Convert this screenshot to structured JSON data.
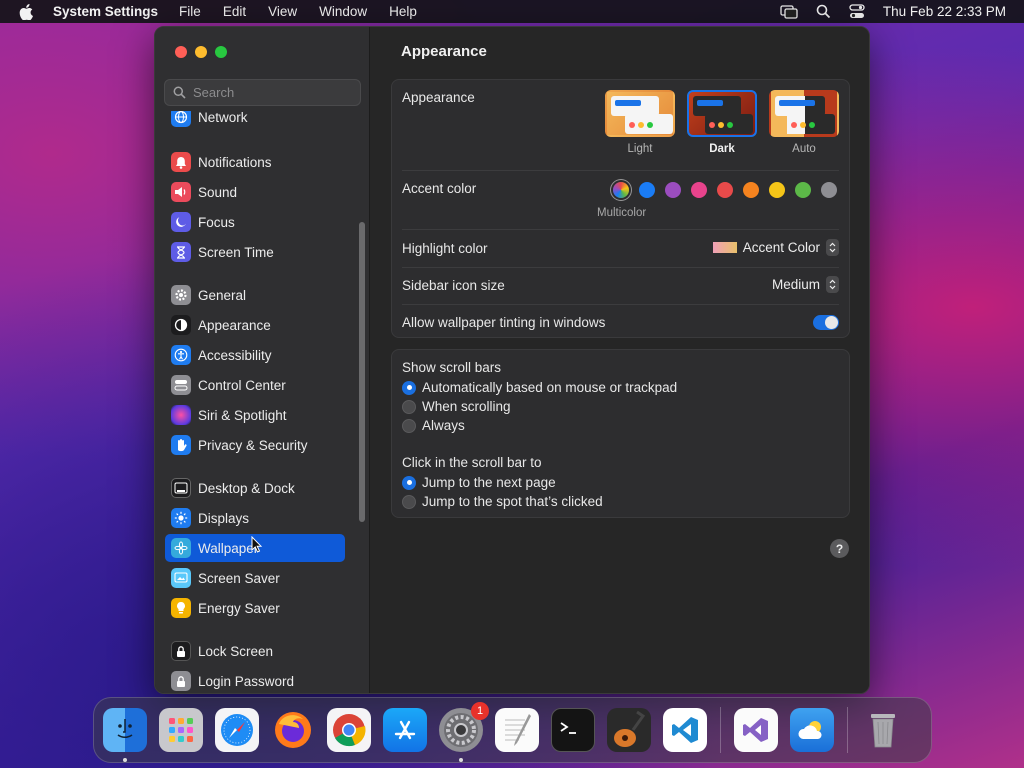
{
  "menubar": {
    "app_name": "System Settings",
    "menus": [
      "File",
      "Edit",
      "View",
      "Window",
      "Help"
    ],
    "datetime": "Thu Feb 22  2:33 PM"
  },
  "sidebar": {
    "search_placeholder": "Search",
    "items": [
      {
        "label": "Network",
        "icon": "network-icon",
        "color": "#1f7cf0"
      },
      {
        "label": "Notifications",
        "icon": "bell-icon",
        "color": "#eb4b4b"
      },
      {
        "label": "Sound",
        "icon": "speaker-icon",
        "color": "#eb4b5c"
      },
      {
        "label": "Focus",
        "icon": "moon-icon",
        "color": "#5e5ce6"
      },
      {
        "label": "Screen Time",
        "icon": "hourglass-icon",
        "color": "#5e5ce6"
      },
      {
        "label": "General",
        "icon": "gear-icon",
        "color": "#8e8e93"
      },
      {
        "label": "Appearance",
        "icon": "appearance-icon",
        "color": "#1c1c1e"
      },
      {
        "label": "Accessibility",
        "icon": "accessibility-icon",
        "color": "#1f7cf0"
      },
      {
        "label": "Control Center",
        "icon": "control-center-icon",
        "color": "#8e8e93"
      },
      {
        "label": "Siri & Spotlight",
        "icon": "siri-icon",
        "color": "#b43ccf"
      },
      {
        "label": "Privacy & Security",
        "icon": "hand-icon",
        "color": "#1f7cf0"
      },
      {
        "label": "Desktop & Dock",
        "icon": "dock-icon",
        "color": "#1c1c1e"
      },
      {
        "label": "Displays",
        "icon": "sun-icon",
        "color": "#1f7cf0"
      },
      {
        "label": "Wallpaper",
        "icon": "flower-icon",
        "color": "#35aadc"
      },
      {
        "label": "Screen Saver",
        "icon": "screen-saver-icon",
        "color": "#5ac8fa"
      },
      {
        "label": "Energy Saver",
        "icon": "bulb-icon",
        "color": "#f5b400"
      },
      {
        "label": "Lock Screen",
        "icon": "lock-icon",
        "color": "#1c1c1e"
      },
      {
        "label": "Login Password",
        "icon": "lock-icon",
        "color": "#8e8e93"
      }
    ],
    "selected": "Wallpaper"
  },
  "main": {
    "title": "Appearance",
    "appearance": {
      "label": "Appearance",
      "options": [
        "Light",
        "Dark",
        "Auto"
      ],
      "selected": "Dark"
    },
    "accent": {
      "label": "Accent color",
      "colors": [
        "multicolor",
        "#1a7cf5",
        "#9b4dbf",
        "#e8438c",
        "#e84a4a",
        "#f5831f",
        "#f5c518",
        "#5cb848",
        "#8e8e93"
      ],
      "selected_name": "Multicolor"
    },
    "highlight": {
      "label": "Highlight color",
      "value": "Accent Color"
    },
    "sidebar_icon_size": {
      "label": "Sidebar icon size",
      "value": "Medium"
    },
    "wallpaper_tinting": {
      "label": "Allow wallpaper tinting in windows",
      "enabled": true
    },
    "scroll_bars": {
      "label": "Show scroll bars",
      "options": [
        "Automatically based on mouse or trackpad",
        "When scrolling",
        "Always"
      ],
      "selected": "Automatically based on mouse or trackpad"
    },
    "scroll_click": {
      "label": "Click in the scroll bar to",
      "options": [
        "Jump to the next page",
        "Jump to the spot that’s clicked"
      ],
      "selected": "Jump to the next page"
    },
    "help": "?"
  },
  "dock": {
    "apps": [
      "Finder",
      "Launchpad",
      "Safari",
      "Firefox",
      "Chrome",
      "App Store",
      "System Settings",
      "TextEdit",
      "Terminal",
      "GarageBand",
      "Visual Studio Code",
      "Visual Studio",
      "Weather",
      "Trash"
    ],
    "settings_badge": "1"
  }
}
